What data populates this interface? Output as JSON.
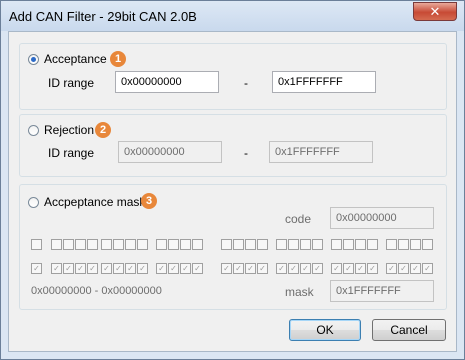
{
  "window": {
    "title": "Add CAN Filter - 29bit CAN 2.0B",
    "close_glyph": "✕"
  },
  "acceptance": {
    "label": "Acceptance",
    "badge": "1",
    "checked": true,
    "id_range_label": "ID range",
    "from": "0x00000000",
    "dash": "-",
    "to": "0x1FFFFFFF"
  },
  "rejection": {
    "label": "Rejection",
    "badge": "2",
    "checked": false,
    "id_range_label": "ID range",
    "from": "0x00000000",
    "dash": "-",
    "to": "0x1FFFFFFF"
  },
  "mask": {
    "label": "Accpeptance mask",
    "badge": "3",
    "checked": false,
    "code_label": "code",
    "code_value": "0x00000000",
    "mask_label": "mask",
    "mask_value": "0x1FFFFFFF",
    "range_text": "0x00000000 - 0x00000000",
    "code_bits": "unchecked",
    "mask_bits": "checked",
    "check_glyph": "✓"
  },
  "buttons": {
    "ok": "OK",
    "cancel": "Cancel"
  }
}
